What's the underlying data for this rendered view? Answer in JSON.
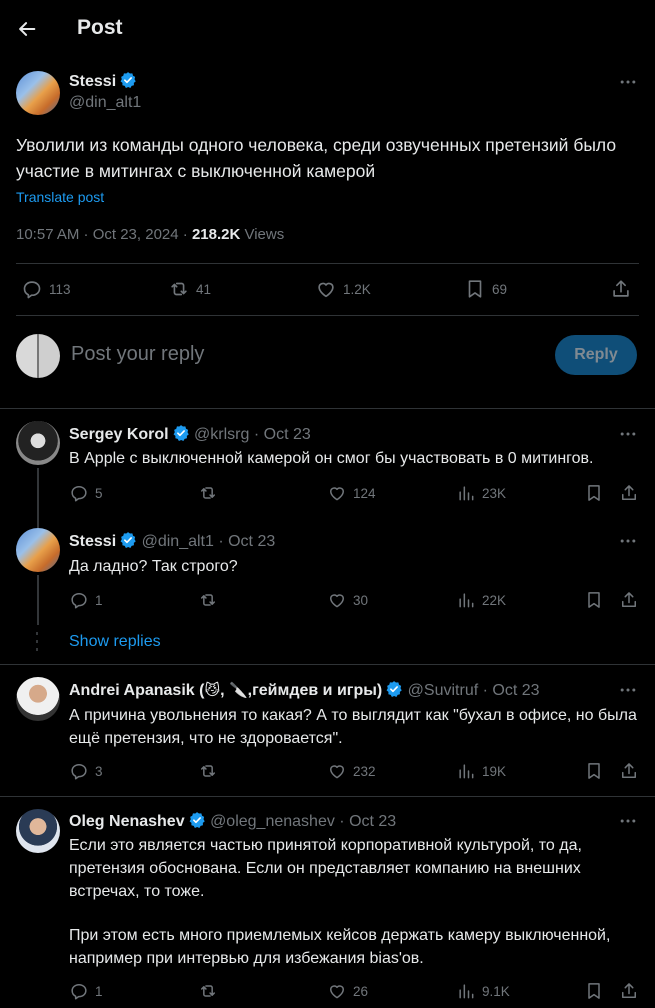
{
  "header": {
    "title": "Post"
  },
  "main_post": {
    "name": "Stessi",
    "handle": "@din_alt1",
    "text": "Уволили из команды одного человека, среди озвученных претензий было участие в митингах с выключенной камерой",
    "translate": "Translate post",
    "time": "10:57 AM · Oct 23, 2024 · ",
    "views_count": "218.2K",
    "views_label": " Views",
    "replies": "113",
    "reposts": "41",
    "likes": "1.2K",
    "bookmarks": "69"
  },
  "composer": {
    "placeholder": "Post your reply",
    "button": "Reply"
  },
  "comments": [
    {
      "name": "Sergey Korol",
      "handle": "@krlsrg · Oct 23",
      "text": "В Apple с выключенной камерой он смог бы участвовать в 0 митингов.",
      "replies": "5",
      "reposts": "",
      "likes": "124",
      "views": "23K"
    },
    {
      "name": "Stessi",
      "handle": "@din_alt1 · Oct 23",
      "text": "Да ладно? Так строго?",
      "replies": "1",
      "reposts": "",
      "likes": "30",
      "views": "22K"
    },
    {
      "name_pre": "Andrei Apanasik (",
      "name_e1": "😼",
      "name_mid": ", ",
      "name_e2": "🔪",
      "name_post": ",геймдев и игры)",
      "handle": "@Suvitruf · Oct 23",
      "text": "А причина увольнения то какая? А то выглядит как \"бухал в офисе, но была ещё претензия, что не здоровается\".",
      "replies": "3",
      "reposts": "",
      "likes": "232",
      "views": "19K"
    },
    {
      "name": "Oleg Nenashev",
      "handle": "@oleg_nenashev · Oct 23",
      "text1": "Если это является частью принятой корпоративной культурой, то да, претензия обоснована. Если он представляет компанию на внешних встречах, то тоже.",
      "text2": "При этом есть много приемлемых кейсов держать камеру выключенной, например при интервью для избежания bias'ов.",
      "replies": "1",
      "reposts": "",
      "likes": "26",
      "views": "9.1K"
    }
  ],
  "show_replies": "Show replies",
  "colors": {
    "accent": "#1d9bf0",
    "muted": "#71767b",
    "text": "#e7e9ea",
    "bg": "#000000",
    "divider": "#2f3336"
  },
  "icons": [
    "arrow-left-icon",
    "verified-badge-icon",
    "more-icon",
    "reply-icon",
    "repost-icon",
    "like-icon",
    "views-icon",
    "bookmark-icon",
    "share-icon"
  ]
}
